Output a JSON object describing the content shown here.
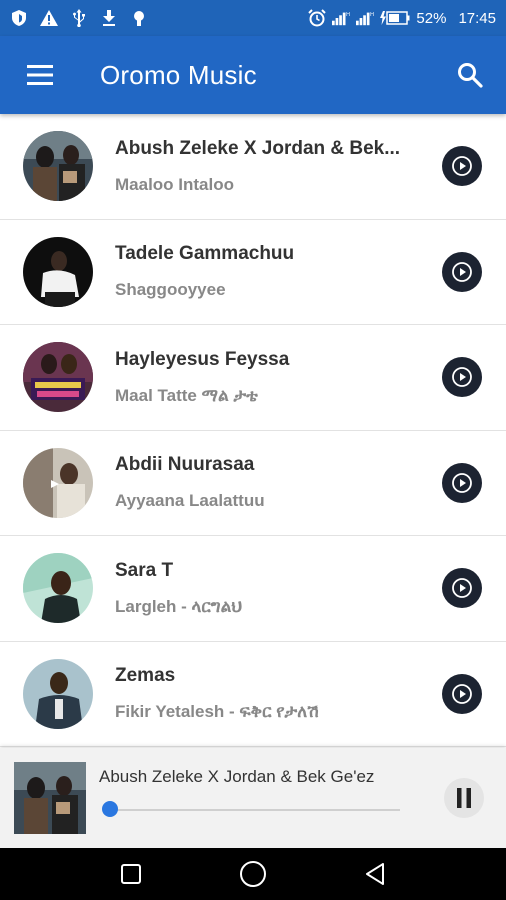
{
  "status_bar": {
    "battery": "52%",
    "time": "17:45"
  },
  "app_bar": {
    "title": "Oromo Music"
  },
  "songs": [
    {
      "artist": "Abush Zeleke X Jordan & Bek...",
      "song": "Maaloo Intaloo"
    },
    {
      "artist": "Tadele Gammachuu",
      "song": "Shaggooyyee"
    },
    {
      "artist": "Hayleyesus Feyssa",
      "song": "Maal Tatte ማል ታቴ"
    },
    {
      "artist": "Abdii Nuurasaa",
      "song": "Ayyaana Laalattuu"
    },
    {
      "artist": "Sara T",
      "song": "Largleh - ላርግልህ"
    },
    {
      "artist": "Zemas",
      "song": "Fikir Yetalesh - ፍቅር የታለሽ"
    }
  ],
  "now_playing": {
    "title": "Abush Zeleke X Jordan & Bek Ge'ez",
    "progress": 0.0
  },
  "colors": {
    "primary": "#2167c4",
    "status_bar": "#1f64b8",
    "play_button": "#1c2331",
    "seek_knob": "#2a77e0"
  },
  "icons": {
    "menu": "menu-icon",
    "search": "search-icon",
    "play": "play-icon",
    "pause": "pause-icon",
    "nav_recents": "square-icon",
    "nav_home": "circle-icon",
    "nav_back": "triangle-back-icon"
  }
}
